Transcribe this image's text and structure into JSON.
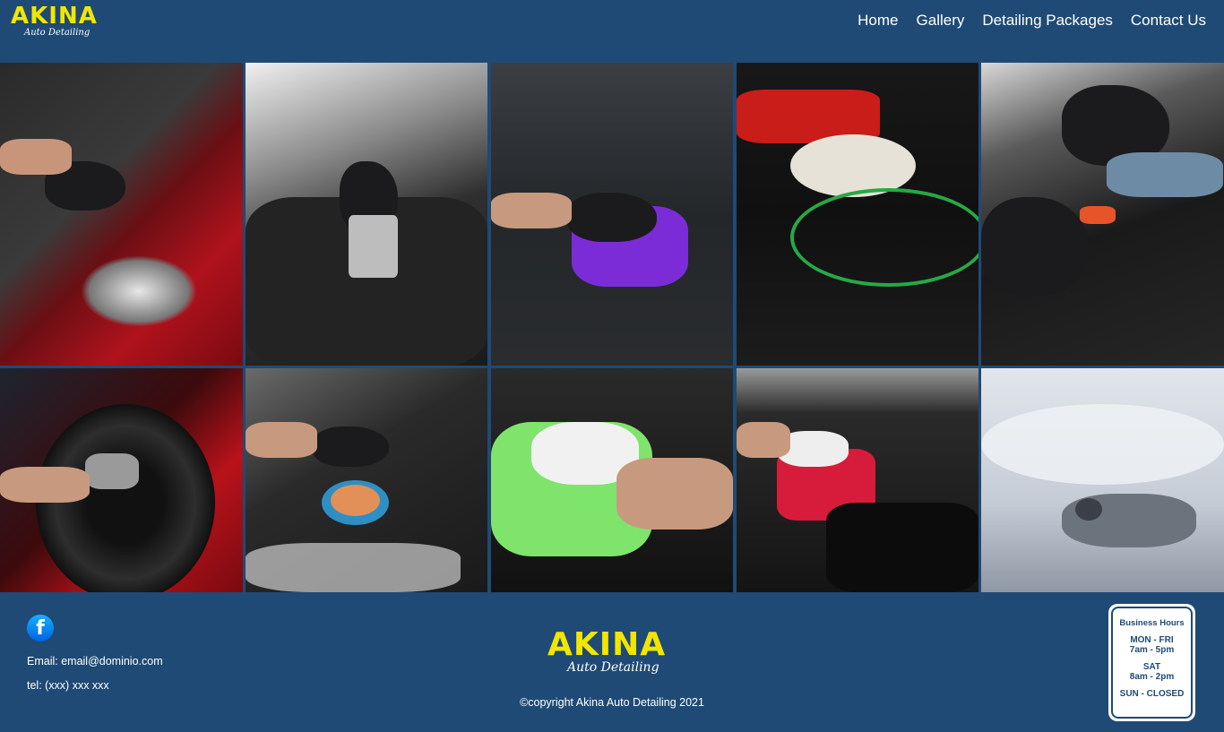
{
  "brand": {
    "name": "AKINA",
    "tagline": "Auto Detailing"
  },
  "nav": {
    "items": [
      {
        "label": "Home"
      },
      {
        "label": "Gallery"
      },
      {
        "label": "Detailing Packages"
      },
      {
        "label": "Contact Us"
      }
    ]
  },
  "gallery": {
    "images": [
      {
        "subject": "red car headlight waxing"
      },
      {
        "subject": "car seat extraction cleaning"
      },
      {
        "subject": "interior console wipe with purple cloth"
      },
      {
        "subject": "red orbital polisher on black hood"
      },
      {
        "subject": "air vent brush detailing"
      },
      {
        "subject": "wheel rim cleaning"
      },
      {
        "subject": "polishing black car with blue pad"
      },
      {
        "subject": "interior wipe with green cloth"
      },
      {
        "subject": "engine bay cleaning with red cloth"
      },
      {
        "subject": "white car covered in foam"
      }
    ]
  },
  "footer": {
    "social_icon": "facebook-icon",
    "email": "Email: email@dominio.com",
    "tel": "tel: (xxx) xxx xxx",
    "copyright": "©copyright Akina Auto Detailing 2021",
    "hours": {
      "title": "Business Hours",
      "weekday_days": "MON - FRI",
      "weekday_time": "7am - 5pm",
      "sat_day": "SAT",
      "sat_time": "8am - 2pm",
      "sunday": "SUN - CLOSED"
    }
  },
  "colors": {
    "background": "#1f4a75",
    "logo_yellow": "#f2e600",
    "text": "#ffffff"
  }
}
